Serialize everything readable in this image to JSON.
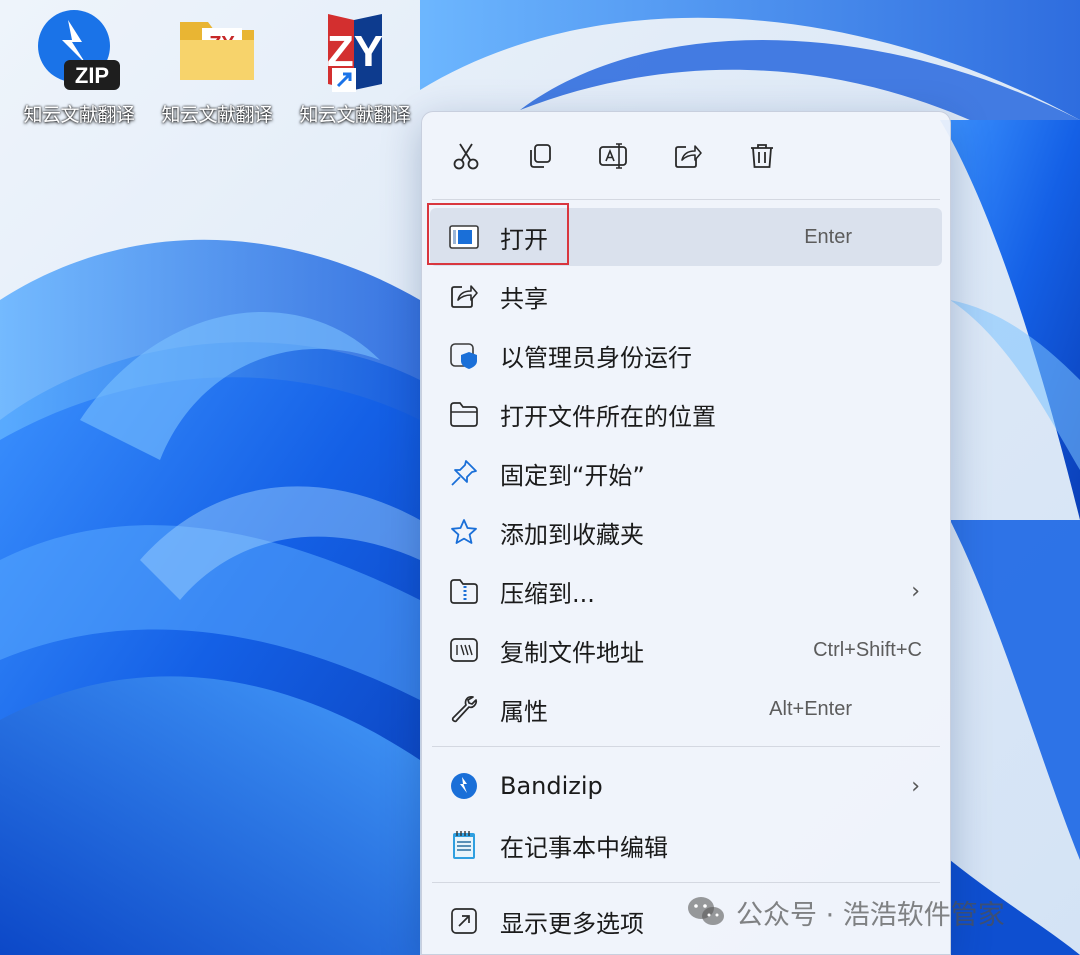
{
  "desktop": {
    "icons": [
      {
        "label": "知云文献翻译",
        "icon": "bandizip-zip-icon",
        "badge": "ZIP"
      },
      {
        "label": "知云文献翻译",
        "icon": "folder-zy-icon",
        "badge": "ZY"
      },
      {
        "label": "知云文献翻译",
        "icon": "zhiyun-shortcut-icon",
        "badge": "ZY"
      }
    ]
  },
  "toolbar": {
    "buttons": [
      {
        "icon": "cut-icon"
      },
      {
        "icon": "copy-icon"
      },
      {
        "icon": "rename-icon"
      },
      {
        "icon": "share-icon"
      },
      {
        "icon": "delete-icon"
      }
    ]
  },
  "menu": {
    "items": [
      {
        "label": "打开",
        "shortcut": "Enter",
        "icon": "open-window-icon"
      },
      {
        "label": "共享",
        "icon": "share-icon"
      },
      {
        "label": "以管理员身份运行",
        "icon": "admin-shield-icon"
      },
      {
        "label": "打开文件所在的位置",
        "icon": "folder-icon"
      },
      {
        "label": "固定到“开始”",
        "icon": "pin-icon"
      },
      {
        "label": "添加到收藏夹",
        "icon": "star-icon"
      },
      {
        "label": "压缩到...",
        "chevron": "›",
        "icon": "zip-folder-icon"
      },
      {
        "label": "复制文件地址",
        "shortcut": "Ctrl+Shift+C",
        "icon": "copy-path-icon"
      },
      {
        "label": "属性",
        "shortcut": "Alt+Enter",
        "icon": "wrench-icon"
      }
    ],
    "extensions": [
      {
        "label": "Bandizip",
        "chevron": "›",
        "icon": "bandizip-icon"
      },
      {
        "label": "在记事本中编辑",
        "icon": "notepad-icon"
      }
    ],
    "more": {
      "label": "显示更多选项",
      "icon": "show-more-icon"
    }
  },
  "watermark": {
    "text": "公众号 · 浩浩软件管家",
    "icon": "wechat-icon"
  },
  "colors": {
    "accent": "#0067c0",
    "highlight_box": "#d9363e",
    "wallpaper_blue": "#1f6fe8"
  }
}
